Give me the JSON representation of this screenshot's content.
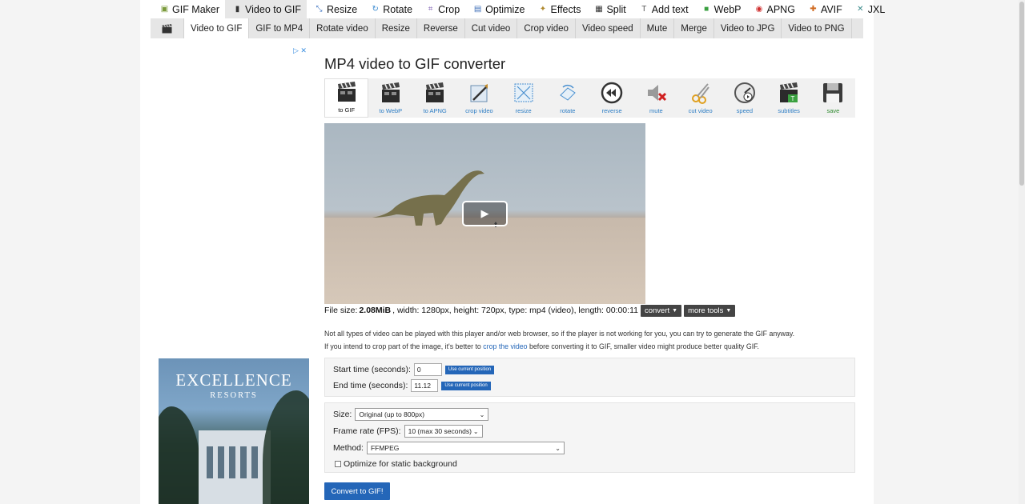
{
  "top_menu": [
    {
      "label": "GIF Maker",
      "icon": "gif-maker-icon",
      "color": "#7a9a3b"
    },
    {
      "label": "Video to GIF",
      "icon": "film-icon",
      "color": "#333333",
      "active": true
    },
    {
      "label": "Resize",
      "icon": "resize-icon",
      "color": "#3a70c0"
    },
    {
      "label": "Rotate",
      "icon": "rotate-icon",
      "color": "#3a8ad0"
    },
    {
      "label": "Crop",
      "icon": "crop-icon",
      "color": "#7a5ab0"
    },
    {
      "label": "Optimize",
      "icon": "optimize-icon",
      "color": "#4070b8"
    },
    {
      "label": "Effects",
      "icon": "effects-icon",
      "color": "#b08a30"
    },
    {
      "label": "Split",
      "icon": "split-icon",
      "color": "#333333"
    },
    {
      "label": "Add text",
      "icon": "add-text-icon",
      "color": "#555555"
    },
    {
      "label": "WebP",
      "icon": "webp-icon",
      "color": "#3aa040"
    },
    {
      "label": "APNG",
      "icon": "apng-icon",
      "color": "#d03030"
    },
    {
      "label": "AVIF",
      "icon": "avif-icon",
      "color": "#d06a20"
    },
    {
      "label": "JXL",
      "icon": "jxl-icon",
      "color": "#3a8a8a"
    }
  ],
  "sub_menu": [
    "Video to GIF",
    "GIF to MP4",
    "Rotate video",
    "Resize",
    "Reverse",
    "Cut video",
    "Crop video",
    "Video speed",
    "Mute",
    "Merge",
    "Video to JPG",
    "Video to PNG"
  ],
  "ad": {
    "close_glyph": "▷ ✕",
    "title": "EXCELLENCE",
    "subtitle": "RESORTS"
  },
  "page_title": "MP4 video to GIF converter",
  "toolbar": [
    {
      "label": "to GIF",
      "icon": "clapperboard-icon",
      "active": true
    },
    {
      "label": "to WebP",
      "icon": "clapperboard-icon"
    },
    {
      "label": "to APNG",
      "icon": "clapperboard-icon"
    },
    {
      "label": "crop video",
      "icon": "crop-video-icon"
    },
    {
      "label": "resize",
      "icon": "resize-video-icon"
    },
    {
      "label": "rotate",
      "icon": "rotate-video-icon"
    },
    {
      "label": "reverse",
      "icon": "reverse-icon"
    },
    {
      "label": "mute",
      "icon": "mute-icon"
    },
    {
      "label": "cut video",
      "icon": "scissors-icon"
    },
    {
      "label": "speed",
      "icon": "speed-icon"
    },
    {
      "label": "subtitles",
      "icon": "subtitles-icon"
    },
    {
      "label": "save",
      "icon": "save-icon",
      "green": true
    }
  ],
  "video": {
    "play_glyph": "▶"
  },
  "file_info": {
    "prefix": "File size:",
    "size": "2.08MiB",
    "rest": ", width: 1280px, height: 720px, type: mp4 (video), length: 00:00:11",
    "convert_label": "convert",
    "more_tools_label": "more tools"
  },
  "note": {
    "line1": "Not all types of video can be played with this player and/or web browser, so if the player is not working for you, you can try to generate the GIF anyway.",
    "line2_a": "If you intend to crop part of the image, it's better to ",
    "line2_link": "crop the video",
    "line2_b": " before converting it to GIF, smaller video might produce better quality GIF."
  },
  "trim": {
    "start_label": "Start time (seconds):",
    "start_value": "0",
    "end_label": "End time (seconds):",
    "end_value": "11.12",
    "use_current": "Use current position"
  },
  "options": {
    "size_label": "Size:",
    "size_value": "Original (up to 800px)",
    "fps_label": "Frame rate (FPS):",
    "fps_value": "10 (max 30 seconds)",
    "method_label": "Method:",
    "method_value": "FFMPEG",
    "static_bg_label": "Optimize for static background"
  },
  "convert_button": "Convert to GIF!"
}
